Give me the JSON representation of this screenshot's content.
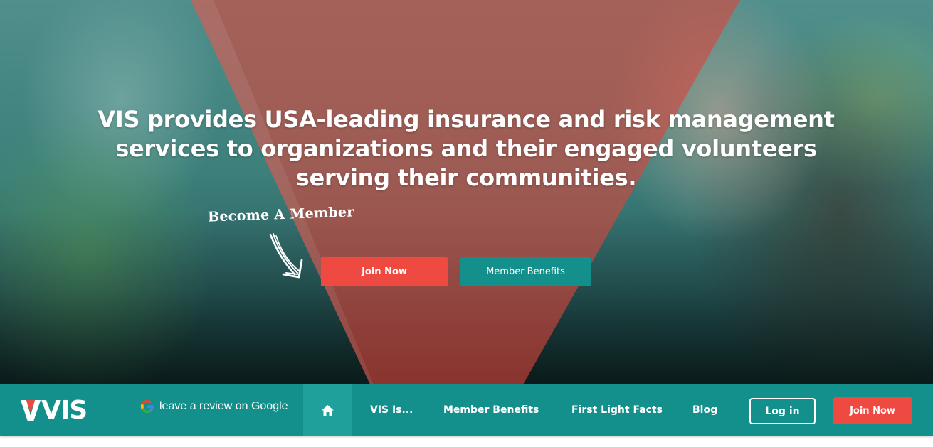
{
  "hero": {
    "headline": "VIS provides USA-leading insurance and risk management services to organizations and their engaged volunteers serving their communities.",
    "become_member": "Become A Member",
    "join_label": "Join Now",
    "benefits_label": "Member Benefits"
  },
  "nav": {
    "logo_text": "VIS",
    "google_review": "leave a review on Google",
    "items": [
      "VIS Is...",
      "Member Benefits",
      "First Light Facts",
      "Blog"
    ],
    "login_label": "Log in",
    "join_label": "Join Now"
  },
  "colors": {
    "teal": "#13908c",
    "accent_red": "#ef4a42",
    "active_nav": "#1fa09b"
  },
  "icons": {
    "home": "home-icon",
    "google": "google-g-icon",
    "arrow": "hand-drawn-arrow-icon"
  }
}
